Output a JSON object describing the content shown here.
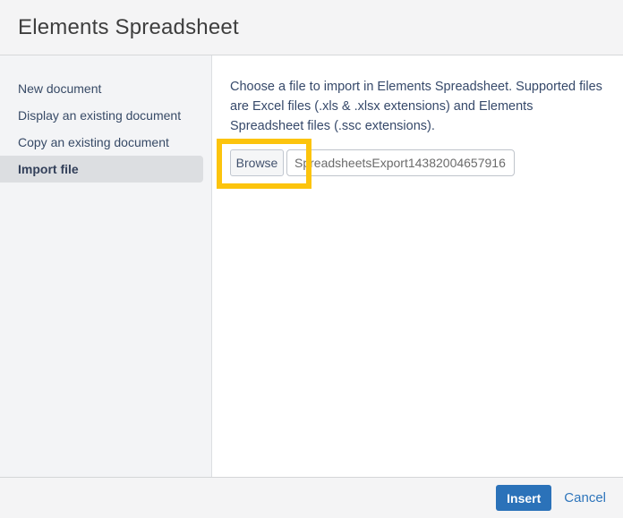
{
  "dialog": {
    "title": "Elements Spreadsheet"
  },
  "sidebar": {
    "items": [
      {
        "label": "New document",
        "selected": false
      },
      {
        "label": "Display an existing document",
        "selected": false
      },
      {
        "label": "Copy an existing document",
        "selected": false
      },
      {
        "label": "Import file",
        "selected": true
      }
    ]
  },
  "content": {
    "description": "Choose a file to import in Elements Spreadsheet. Supported files are Excel files (.xls & .xlsx extensions) and Elements Spreadsheet files (.ssc extensions).",
    "browse_label": "Browse",
    "file_input_value": "SpreadsheetsExport14382004657916"
  },
  "footer": {
    "insert_label": "Insert",
    "cancel_label": "Cancel"
  },
  "annotation": {
    "highlight_color": "#fcc40d",
    "highlighted_element": "browse-button"
  },
  "colors": {
    "header_background": "#f4f4f5",
    "sidebar_background": "#f3f4f6",
    "selected_item_background": "#dcdee1",
    "primary_button_blue": "#2b72b9",
    "link_blue": "#2e75bb",
    "text_navy": "#374a66"
  }
}
